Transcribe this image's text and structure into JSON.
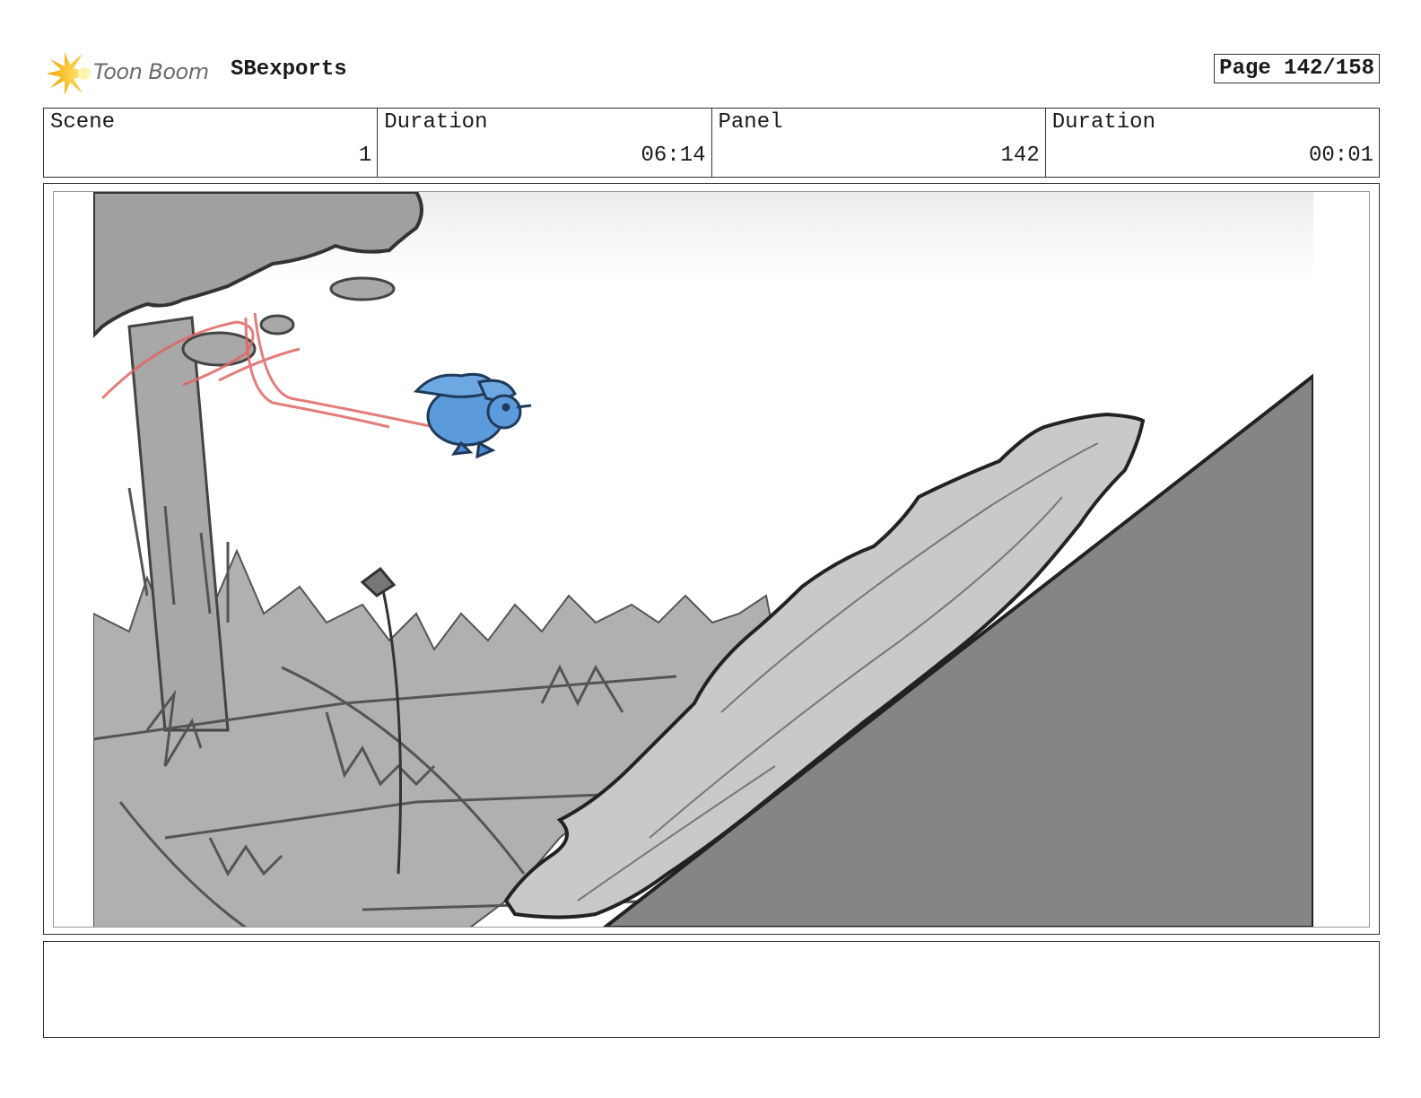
{
  "header": {
    "brand": "Toon Boom",
    "project": "SBexports",
    "page": "Page 142/158"
  },
  "info": {
    "scene_label": "Scene",
    "scene_value": "1",
    "scene_duration_label": "Duration",
    "scene_duration_value": "06:14",
    "panel_label": "Panel",
    "panel_value": "142",
    "panel_duration_label": "Duration",
    "panel_duration_value": "00:01"
  },
  "notes": {
    "text": ""
  },
  "colors": {
    "character_blue": "#5b9bdc",
    "motion_red": "#e06666",
    "log_gray": "#c9c9c9",
    "hill_gray": "#858585",
    "bg_gray": "#b0b0b0",
    "logo_yellow": "#f5c518"
  },
  "icons": {
    "logo": "toon-boom-starburst-icon"
  }
}
